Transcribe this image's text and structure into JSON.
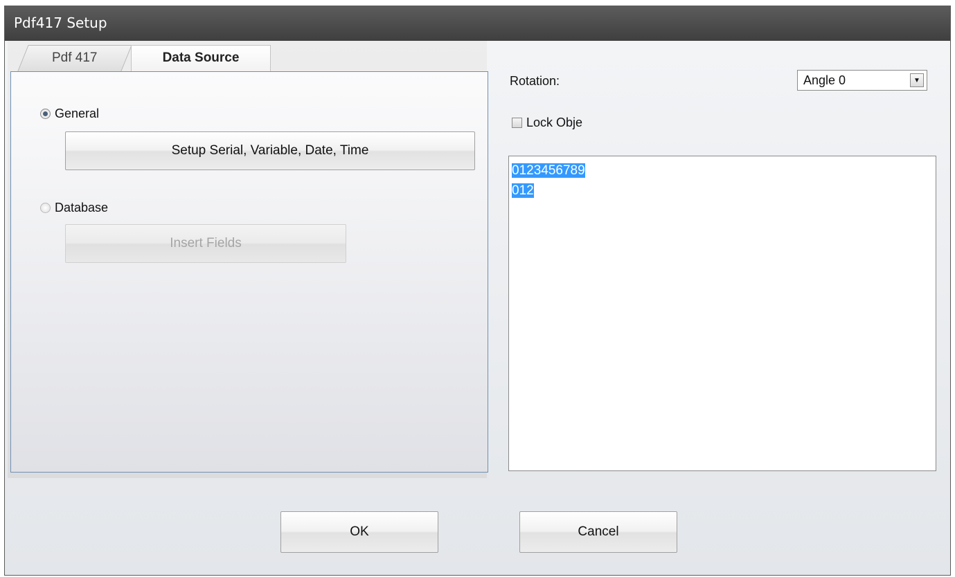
{
  "window": {
    "title": "Pdf417 Setup"
  },
  "tabs": [
    {
      "label": "Pdf 417",
      "active": false
    },
    {
      "label": "Data Source",
      "active": true
    }
  ],
  "data_source": {
    "general_label": "General",
    "general_selected": true,
    "setup_button_label": "Setup Serial, Variable, Date, Time",
    "database_label": "Database",
    "database_selected": false,
    "insert_fields_label": "Insert Fields",
    "insert_fields_enabled": false
  },
  "rotation": {
    "label": "Rotation:",
    "value": "Angle 0"
  },
  "lock_object": {
    "label": "Lock Obje",
    "checked": false
  },
  "data_text": {
    "lines": [
      "0123456789",
      "012"
    ],
    "selected": true
  },
  "buttons": {
    "ok_label": "OK",
    "cancel_label": "Cancel"
  },
  "colors": {
    "selection": "#3399ff",
    "panel_border": "#6f8fb5",
    "titlebar": "#4a4a4a"
  }
}
